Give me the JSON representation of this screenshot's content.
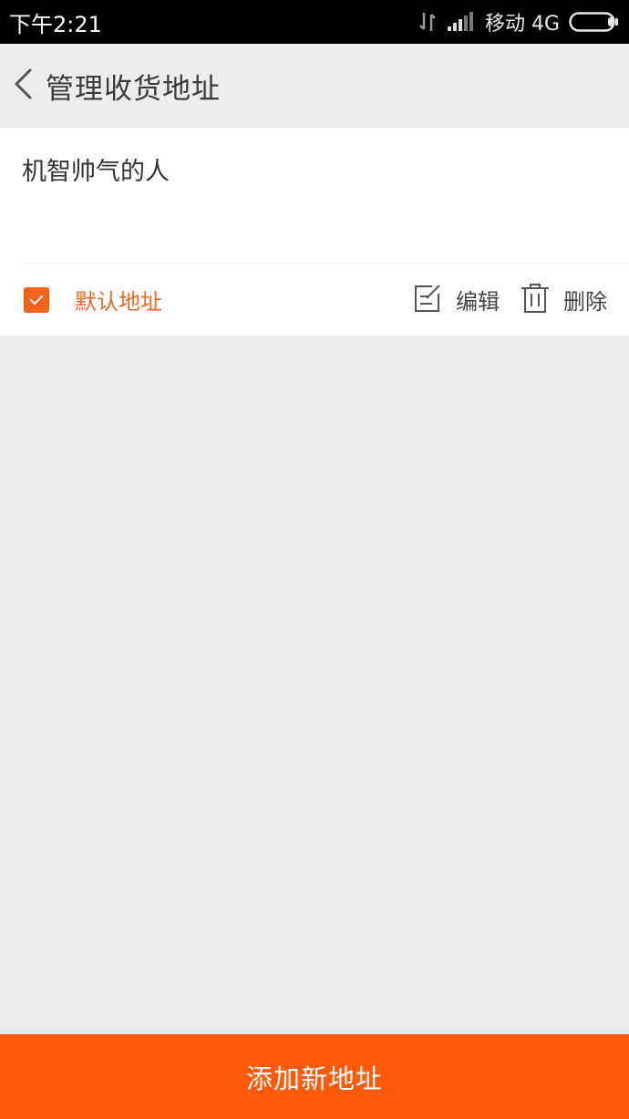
{
  "status_bar": {
    "time": "下午2:21",
    "carrier": "移动 4G",
    "icons": [
      "data-transfer-icon",
      "signal-icon",
      "battery-icon"
    ]
  },
  "nav": {
    "back_icon": "chevron-left-icon",
    "title": "管理收货地址"
  },
  "address": {
    "name": "机智帅气的人",
    "default_label": "默认地址",
    "is_default": true,
    "edit_label": "编辑",
    "delete_label": "删除"
  },
  "footer": {
    "add_label": "添加新地址"
  },
  "colors": {
    "accent": "#ff5a0a",
    "default_text": "#e8682a",
    "background": "#ebebed"
  }
}
